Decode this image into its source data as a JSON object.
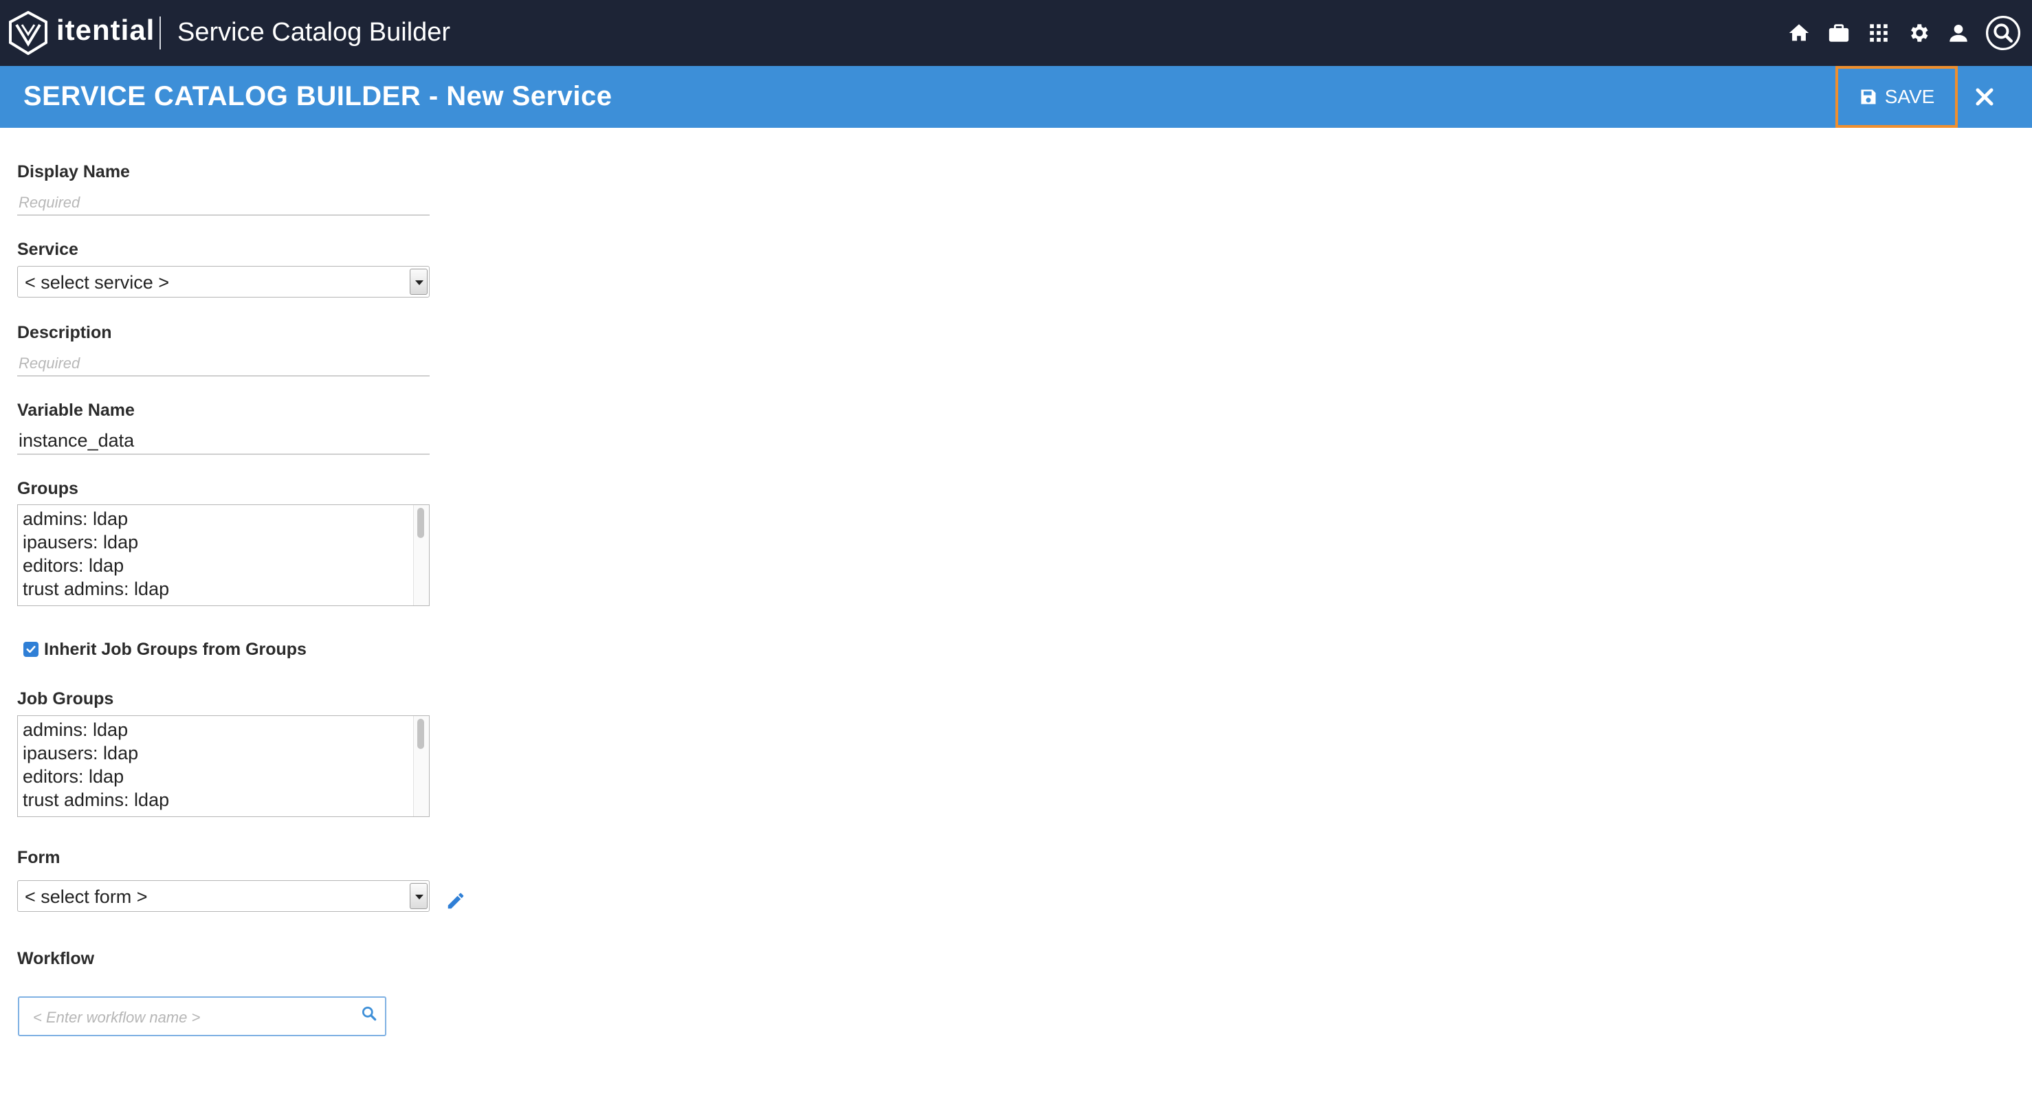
{
  "nav": {
    "brand": "itential",
    "app_title": "Service Catalog Builder",
    "icons": [
      "home-icon",
      "briefcase-icon",
      "apps-grid-icon",
      "gear-icon",
      "user-icon",
      "search-icon"
    ]
  },
  "titlebar": {
    "title": "SERVICE CATALOG BUILDER - New Service",
    "save_label": "SAVE"
  },
  "form": {
    "display_name": {
      "label": "Display Name",
      "placeholder": "Required",
      "value": ""
    },
    "service": {
      "label": "Service",
      "selected": "< select service >"
    },
    "description": {
      "label": "Description",
      "placeholder": "Required",
      "value": ""
    },
    "variable_name": {
      "label": "Variable Name",
      "value": "instance_data"
    },
    "groups": {
      "label": "Groups",
      "items": [
        "admins: ldap",
        "ipausers: ldap",
        "editors: ldap",
        "trust admins: ldap"
      ]
    },
    "inherit": {
      "label": "Inherit Job Groups from Groups",
      "checked": true
    },
    "job_groups": {
      "label": "Job Groups",
      "items": [
        "admins: ldap",
        "ipausers: ldap",
        "editors: ldap",
        "trust admins: ldap"
      ]
    },
    "form_select": {
      "label": "Form",
      "selected": "< select form >"
    },
    "workflow": {
      "label": "Workflow",
      "placeholder": "< Enter workflow name >"
    }
  },
  "colors": {
    "nav_bg": "#1d2436",
    "title_bg": "#3d8fd8",
    "save_highlight": "#ef8f2e",
    "accent": "#2f7fd6"
  }
}
